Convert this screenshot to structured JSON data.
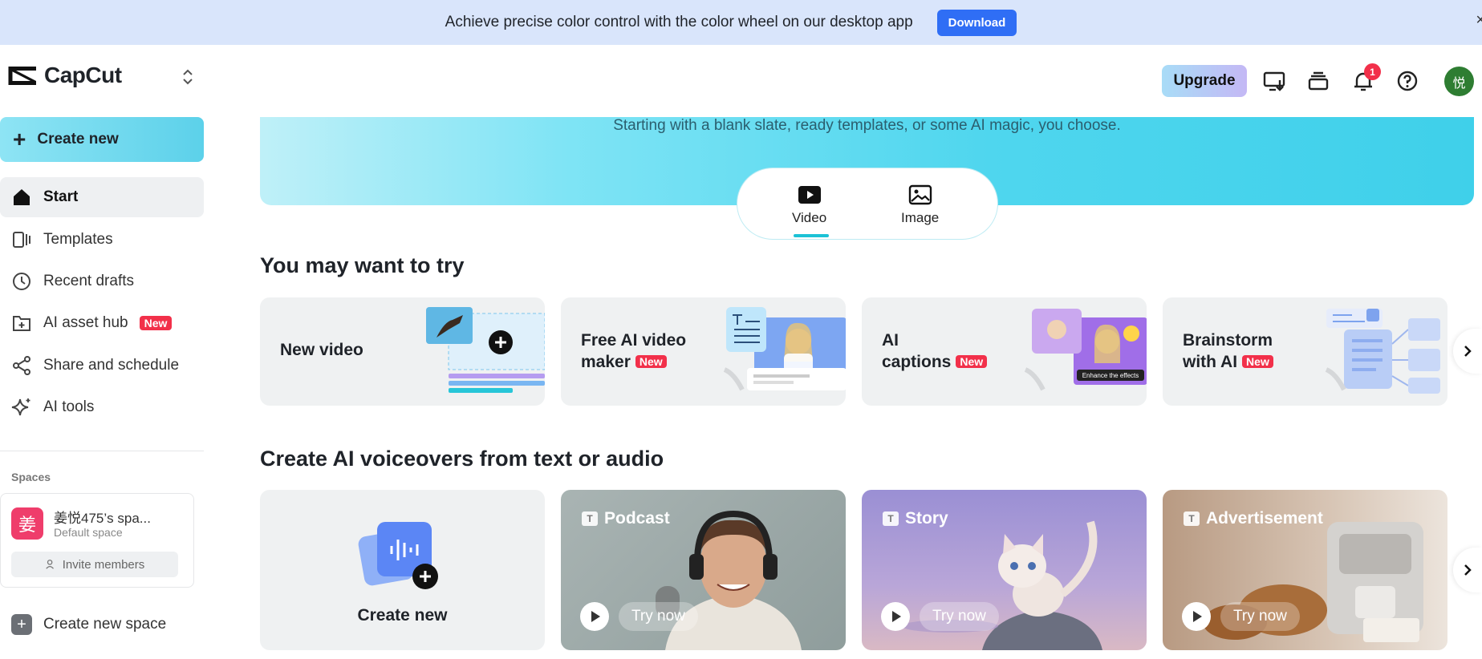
{
  "banner": {
    "text": "Achieve precise color control with the color wheel on our desktop app",
    "button": "Download",
    "close": "×"
  },
  "app": {
    "name": "CapCut"
  },
  "header": {
    "upgrade": "Upgrade",
    "notification_count": "1",
    "avatar": "悦"
  },
  "sidebar": {
    "create_new": "Create new",
    "items": [
      {
        "label": "Start",
        "icon": "home-icon",
        "active": true
      },
      {
        "label": "Templates",
        "icon": "templates-icon"
      },
      {
        "label": "Recent drafts",
        "icon": "clock-icon"
      },
      {
        "label": "AI asset hub",
        "icon": "asset-hub-icon",
        "badge": "New"
      },
      {
        "label": "Share and schedule",
        "icon": "share-icon"
      },
      {
        "label": "AI tools",
        "icon": "sparkle-icon"
      }
    ],
    "spaces_label": "Spaces",
    "space": {
      "avatar": "姜",
      "name": "姜悦475’s spa...",
      "sub": "Default space",
      "invite": "Invite members"
    },
    "create_space": "Create new space"
  },
  "hero": {
    "subtitle": "Starting with a blank slate, ready templates, or some AI magic, you choose.",
    "tabs": [
      {
        "label": "Video",
        "active": true
      },
      {
        "label": "Image"
      }
    ]
  },
  "try_section": {
    "title": "You may want to try",
    "cards": [
      {
        "line1": "New video",
        "line2": "",
        "badge": ""
      },
      {
        "line1": "Free AI video",
        "line2": "maker",
        "badge": "New"
      },
      {
        "line1": "AI",
        "line2": "captions",
        "badge": "New",
        "thumb_caption": "Enhance the effects"
      },
      {
        "line1": "Brainstorm",
        "line2": "with AI",
        "badge": "New"
      }
    ]
  },
  "voice_section": {
    "title": "Create AI voiceovers from text or audio",
    "create_new": "Create new",
    "cards": [
      {
        "label": "Podcast",
        "try": "Try now"
      },
      {
        "label": "Story",
        "try": "Try now"
      },
      {
        "label": "Advertisement",
        "try": "Try now"
      }
    ]
  },
  "colors": {
    "accent": "#2f6ef5",
    "badge": "#f2304a",
    "hero": "#4fd6ee"
  }
}
